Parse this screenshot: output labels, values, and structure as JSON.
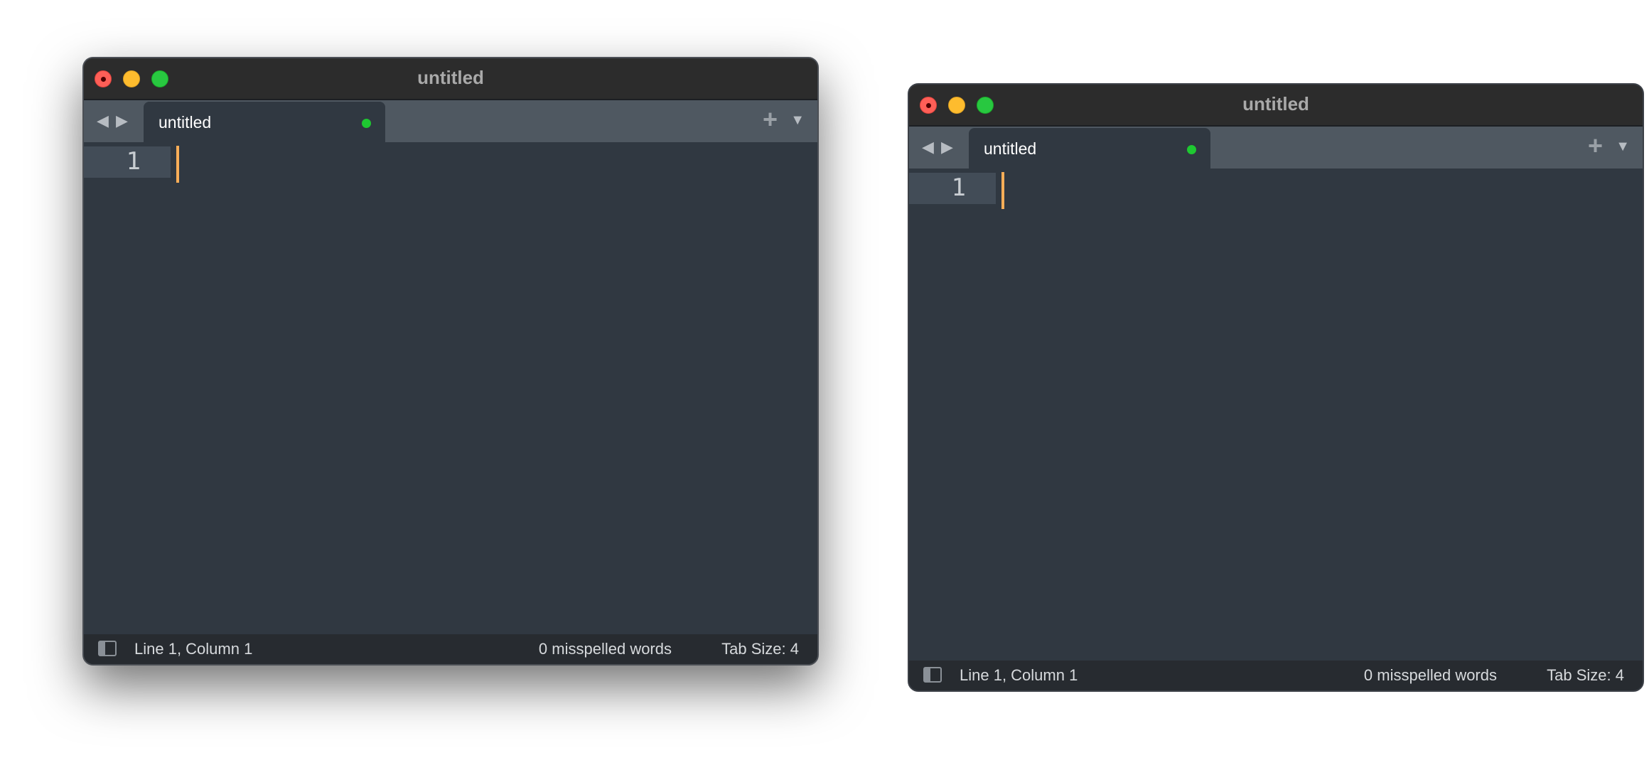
{
  "windows": [
    {
      "title": "untitled",
      "tab": {
        "label": "untitled",
        "dirty_color": "#1ec831"
      },
      "editor": {
        "line_number": "1",
        "caret_color": "#f9ae58"
      },
      "statusbar": {
        "position": "Line 1, Column 1",
        "spelling": "0 misspelled words",
        "tab_size": "Tab Size: 4"
      }
    },
    {
      "title": "untitled",
      "tab": {
        "label": "untitled",
        "dirty_color": "#1ec831"
      },
      "editor": {
        "line_number": "1",
        "caret_color": "#f9ae58"
      },
      "statusbar": {
        "position": "Line 1, Column 1",
        "spelling": "0 misspelled words",
        "tab_size": "Tab Size: 4"
      }
    }
  ],
  "icons": {
    "back": "◀",
    "forward": "▶",
    "new_tab": "+",
    "tab_menu": "▼"
  },
  "colors": {
    "editor_bg": "#303841",
    "tabbar_bg": "#4f5861",
    "statusbar_bg": "#272b30",
    "titlebar_bg": "#2c2c2c"
  }
}
